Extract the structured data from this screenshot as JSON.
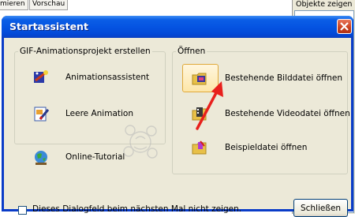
{
  "background_app": {
    "tabs": [
      "mieren",
      "Vorschau"
    ],
    "right_panel_label": "Objekte zeigen"
  },
  "dialog": {
    "title": "Startassistent",
    "group_create": {
      "legend": "GIF-Animationsprojekt erstellen",
      "items": [
        {
          "label": "Animationsassistent",
          "icon": "wizard-wand-icon"
        },
        {
          "label": "Leere Animation",
          "icon": "blank-document-pencil-icon"
        }
      ]
    },
    "tutorial": {
      "label": "Online-Tutorial",
      "icon": "globe-icon"
    },
    "group_open": {
      "legend": "Öffnen",
      "items": [
        {
          "label": "Bestehende Bilddatei öffnen",
          "icon": "folder-image-icon"
        },
        {
          "label": "Bestehende Videodatei öffnen",
          "icon": "folder-film-icon"
        },
        {
          "label": "Beispieldatei öffnen",
          "icon": "folder-sample-icon"
        }
      ]
    },
    "checkbox_label": "Dieses Dialogfeld beim nächsten Mal nicht zeigen.",
    "checkbox_checked": false,
    "close_button_label": "Schließen"
  },
  "colors": {
    "titlebar": "#0554e2",
    "client": "#ece9d8",
    "annotation_arrow": "#e8201c"
  }
}
